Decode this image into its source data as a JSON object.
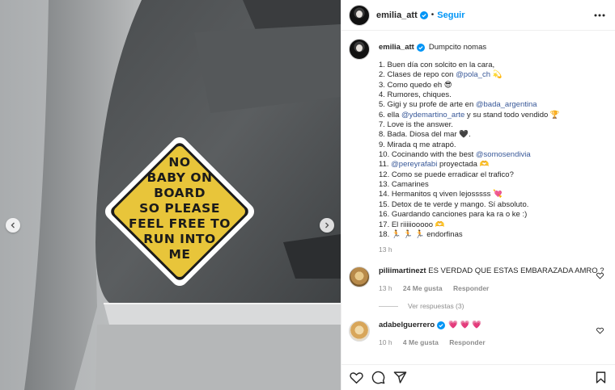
{
  "post": {
    "author": "emilia_att",
    "follow_label": "Seguir",
    "separator": "•",
    "sticker_lines": [
      "NO",
      "BABY ON",
      "BOARD",
      "SO PLEASE",
      "FEEL FREE TO",
      "RUN INTO",
      "ME"
    ],
    "caption_title": "Dumpcito nomas",
    "caption_lines": [
      "1. Buen día con solcito en la cara,",
      "2. Clases de repo con ",
      "3. Como quedo eh 😎",
      "4. Rumores, chiques.",
      "5. Gigi y su profe de arte en ",
      "6. ella ",
      "7. Love is the answer.",
      "8. Bada. Diosa del mar 🖤.",
      "9. Mirada q me atrapó.",
      "10. Cocinando with the best ",
      "11. ",
      "12. Como se puede erradicar el trafico?",
      "13. Camarines",
      "14. Hermanitos q viven lejosssss 💘",
      "15. Detox de te verde y mango. Sí absoluto.",
      "16. Guardando canciones para ka ra o ke :)",
      "17. El riiiiiooooo 🫶",
      "18. 🏃 🏃 🏃 endorfinas"
    ],
    "mentions": {
      "pola": "@pola_ch",
      "pola_after": " 💫",
      "bada": "@bada_argentina",
      "ydemartino": "@ydemartino_arte",
      "ydemartino_after": " y su stand todo vendido 🏆",
      "somosendivia": "@somosendivia",
      "pereyrafabi": "@pereyrafabi",
      "pereyrafabi_after": " proyectada 🫶"
    },
    "caption_time": "13 h"
  },
  "comments": [
    {
      "user": "piliimartinezt",
      "text": "ES VERDAD QUE ESTAS EMBARAZADA AMRO ?",
      "time": "13 h",
      "likes": "24 Me gusta",
      "reply": "Responder",
      "replies": "Ver respuestas (3)"
    },
    {
      "user": "adabelguerrero",
      "text": "💗 💗 💗",
      "time": "10 h",
      "likes": "4 Me gusta",
      "reply": "Responder"
    }
  ],
  "colors": {
    "link": "#0095f6",
    "mention": "#00376b",
    "muted": "#8e8e8e",
    "sticker_yellow": "#e8c53a"
  },
  "icons": [
    "verified-icon",
    "more-icon",
    "heart-icon",
    "comment-icon",
    "share-icon",
    "save-icon",
    "chevron-left-icon",
    "chevron-right-icon"
  ]
}
